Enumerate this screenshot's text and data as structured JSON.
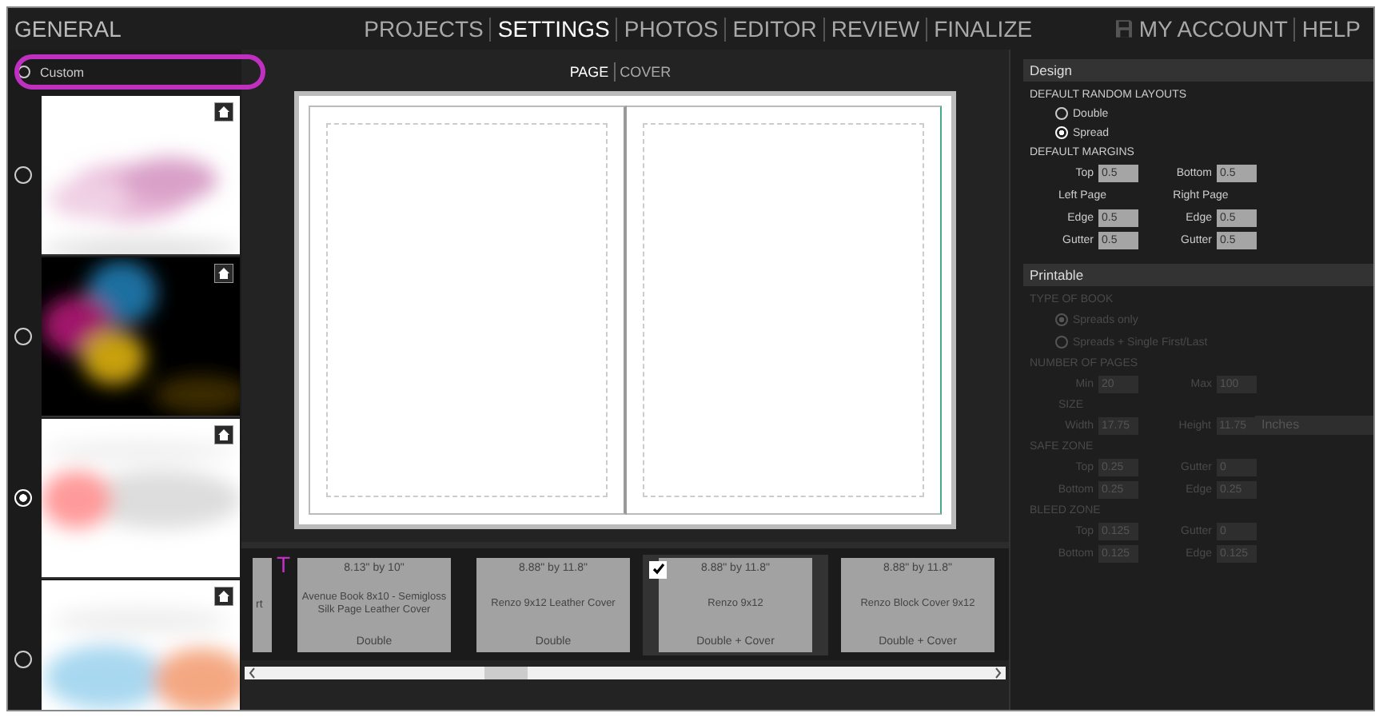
{
  "nav": {
    "brand": "GENERAL",
    "items": [
      {
        "label": "PROJECTS",
        "selected": false
      },
      {
        "label": "SETTINGS",
        "selected": true
      },
      {
        "label": "PHOTOS",
        "selected": false
      },
      {
        "label": "EDITOR",
        "selected": false
      },
      {
        "label": "REVIEW",
        "selected": false
      },
      {
        "label": "FINALIZE",
        "selected": false
      }
    ],
    "account": [
      "MY ACCOUNT",
      "HELP"
    ]
  },
  "sidebar": {
    "custom": {
      "label": "Custom",
      "selected": false
    },
    "themes": [
      {
        "selected": false,
        "kind": "picture"
      },
      {
        "selected": false,
        "kind": "picture"
      },
      {
        "selected": true,
        "kind": "picture"
      },
      {
        "selected": false,
        "kind": "picture"
      }
    ]
  },
  "view_tabs": [
    {
      "label": "PAGE",
      "selected": true
    },
    {
      "label": "COVER",
      "selected": false
    }
  ],
  "annotation": "T",
  "books": [
    {
      "kind": "partial",
      "name": "rt"
    },
    {
      "kind": "card",
      "size": "8.13\" by 10\"",
      "name": "Avenue Book 8x10 - Semigloss Silk Page Leather Cover",
      "type": "Double",
      "checked": false
    },
    {
      "kind": "card",
      "size": "8.88\" by 11.8\"",
      "name": "Renzo 9x12 Leather Cover",
      "type": "Double",
      "checked": false
    },
    {
      "kind": "card",
      "size": "8.88\" by 11.8\"",
      "name": "Renzo 9x12",
      "type": "Double + Cover",
      "checked": true
    },
    {
      "kind": "card",
      "size": "8.88\" by 11.8\"",
      "name": "Renzo Block Cover 9x12",
      "type": "Double + Cover",
      "checked": false
    }
  ],
  "panels": [
    {
      "title": "Design",
      "disabled": false,
      "rows": [
        {
          "kind": "heading",
          "text": "DEFAULT RANDOM LAYOUTS"
        },
        {
          "kind": "radio",
          "label": "Double",
          "selected": false
        },
        {
          "kind": "radio",
          "label": "Spread",
          "selected": true
        },
        {
          "kind": "heading",
          "text": "DEFAULT MARGINS"
        },
        {
          "kind": "fields",
          "fields": [
            {
              "label": "Top",
              "value": "0.5"
            },
            {
              "label": "Bottom",
              "value": "0.5"
            }
          ]
        },
        {
          "kind": "subheads",
          "labels": [
            "Left Page",
            "Right Page"
          ]
        },
        {
          "kind": "fields",
          "fields": [
            {
              "label": "Edge",
              "value": "0.5"
            },
            {
              "label": "Edge",
              "value": "0.5"
            }
          ]
        },
        {
          "kind": "fields",
          "fields": [
            {
              "label": "Gutter",
              "value": "0.5"
            },
            {
              "label": "Gutter",
              "value": "0.5"
            }
          ]
        }
      ]
    },
    {
      "title": "Printable",
      "disabled": true,
      "rows": [
        {
          "kind": "heading",
          "text": "TYPE OF BOOK"
        },
        {
          "kind": "radio",
          "label": "Spreads only",
          "selected": true
        },
        {
          "kind": "radio",
          "label": "Spreads + Single First/Last",
          "selected": false
        },
        {
          "kind": "heading",
          "text": "NUMBER OF PAGES"
        },
        {
          "kind": "fields",
          "fields": [
            {
              "label": "Min",
              "value": "20"
            },
            {
              "label": "Max",
              "value": "100"
            }
          ]
        },
        {
          "kind": "subheading",
          "text": "SIZE"
        },
        {
          "kind": "fields",
          "fields": [
            {
              "label": "Width",
              "value": "17.75"
            },
            {
              "label": "Height",
              "value": "11.75"
            }
          ],
          "select": "Inches"
        },
        {
          "kind": "heading",
          "text": "SAFE ZONE"
        },
        {
          "kind": "fields",
          "fields": [
            {
              "label": "Top",
              "value": "0.25"
            },
            {
              "label": "Gutter",
              "value": "0"
            }
          ]
        },
        {
          "kind": "fields",
          "fields": [
            {
              "label": "Bottom",
              "value": "0.25"
            },
            {
              "label": "Edge",
              "value": "0.25"
            }
          ]
        },
        {
          "kind": "heading",
          "text": "BLEED ZONE"
        },
        {
          "kind": "fields",
          "fields": [
            {
              "label": "Top",
              "value": "0.125"
            },
            {
              "label": "Gutter",
              "value": "0"
            }
          ]
        },
        {
          "kind": "fields",
          "fields": [
            {
              "label": "Bottom",
              "value": "0.125"
            },
            {
              "label": "Edge",
              "value": "0.125"
            }
          ]
        }
      ]
    }
  ]
}
